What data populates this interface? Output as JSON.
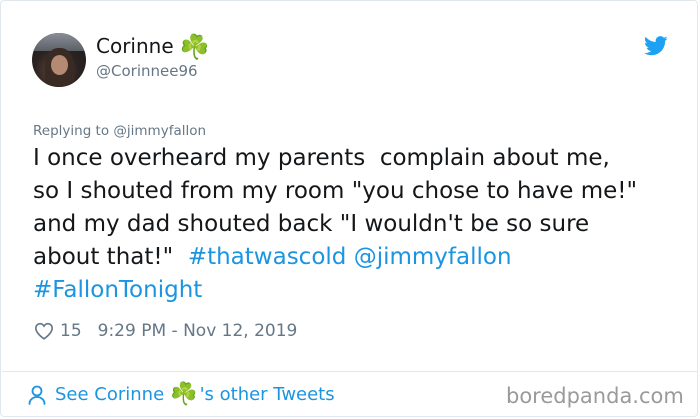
{
  "user": {
    "name": "Corinne",
    "name_emoji": "☘️",
    "handle": "@Corinnee96"
  },
  "reply": {
    "prefix": "Replying to ",
    "mention": "@jimmyfallon"
  },
  "tweet": {
    "line1": "I once overheard my parents  complain about me,",
    "line2": "so I shouted from my room \"you chose to have me!\"",
    "line3": "and my dad shouted back \"I wouldn't be so sure",
    "line4_text": "about that!\"  ",
    "hashtag1": "#thatwascold",
    "mention": "@jimmyfallon",
    "hashtag2": "#FallonTonight"
  },
  "meta": {
    "likes": "15",
    "timestamp": "9:29 PM - Nov 12, 2019"
  },
  "footer": {
    "prefix": "See Corinne ",
    "emoji": "☘️",
    "suffix": "'s other Tweets"
  },
  "watermark": "boredpanda.com",
  "colors": {
    "link": "#1b95e0",
    "muted": "#657786",
    "text": "#14171a",
    "shamrock": "#3aa34a"
  },
  "icons": [
    "avatar",
    "twitter-bird-icon",
    "heart-icon",
    "person-icon",
    "shamrock-icon"
  ]
}
